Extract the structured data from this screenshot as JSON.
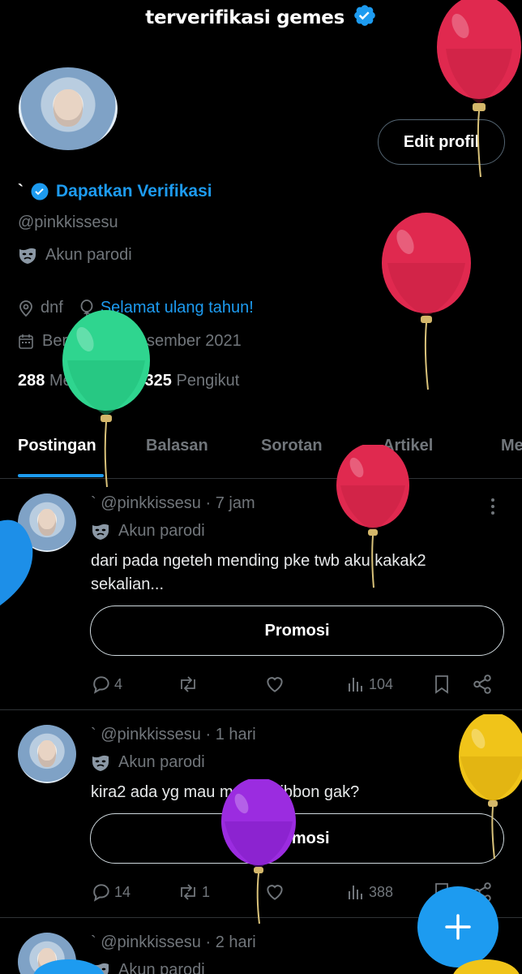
{
  "header": {
    "title": "terverifikasi gemes"
  },
  "profile": {
    "edit_label": "Edit profil",
    "display_name": "`",
    "get_verified": "Dapatkan Verifikasi",
    "handle": "@pinkkissesu",
    "parody_label": "Akun parodi",
    "location": "dnf",
    "birthday": "Selamat ulang tahun!",
    "joined": "Bergabung Desember 2021",
    "following_count": "288",
    "following_label": "Mengikuti",
    "followers_count": "325",
    "followers_label": "Pengikut"
  },
  "tabs": [
    "Postingan",
    "Balasan",
    "Sorotan",
    "Artikel",
    "Me"
  ],
  "posts": [
    {
      "name": "`",
      "handle": "@pinkkissesu",
      "time": "· 7 jam",
      "parody": "Akun parodi",
      "text": "dari pada ngeteh mending pke twb aku kakak2 sekalian...",
      "promo": "Promosi",
      "replies": "4",
      "reposts": "",
      "views": "104"
    },
    {
      "name": "`",
      "handle": "@pinkkissesu",
      "time": "· 1 hari",
      "parody": "Akun parodi",
      "text": "kira2 ada yg mau make twibbon gak?",
      "promo": "Promosi",
      "replies": "14",
      "reposts": "1",
      "views": "388"
    },
    {
      "name": "`",
      "handle": "@pinkkissesu",
      "time": "· 2 hari",
      "parody": "Akun parodi"
    }
  ],
  "colors": {
    "accent": "#1d9bf0",
    "balloon_red": "#e0294f",
    "balloon_green": "#2fd58f",
    "balloon_purple": "#9b2ce0",
    "balloon_yellow": "#f0c419",
    "balloon_blue": "#1d8fe8"
  },
  "icons": [
    "verified-badge-icon",
    "mask-icon",
    "location-icon",
    "balloon-icon",
    "calendar-icon",
    "reply-icon",
    "repost-icon",
    "like-icon",
    "views-icon",
    "bookmark-icon",
    "share-icon",
    "more-icon",
    "plus-icon"
  ]
}
